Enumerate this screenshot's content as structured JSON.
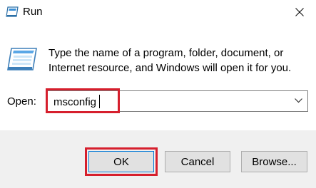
{
  "window": {
    "title": "Run",
    "icon": "run-app-icon",
    "close_icon": "close-icon"
  },
  "description": "Type the name of a program, folder, document, or Internet resource, and Windows will open it for you.",
  "open": {
    "label": "Open:",
    "value": "msconfig",
    "dropdown_icon": "chevron-down-icon"
  },
  "buttons": {
    "ok": "OK",
    "cancel": "Cancel",
    "browse": "Browse..."
  },
  "colors": {
    "highlight": "#d61f2d",
    "default_button_border": "#0078d7",
    "footer_bg": "#f0f0f0"
  }
}
